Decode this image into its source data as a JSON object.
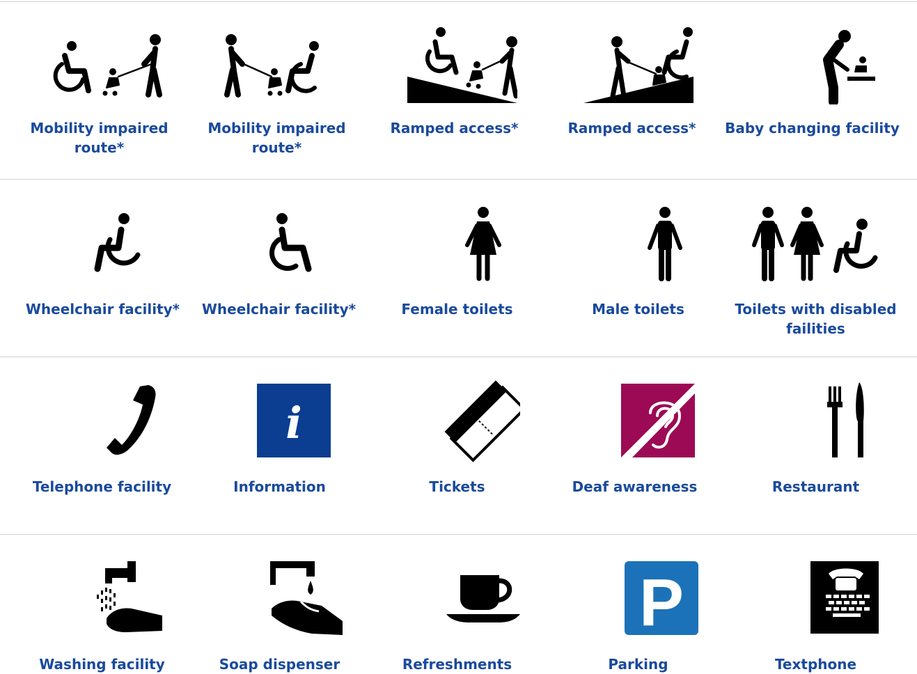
{
  "colors": {
    "label": "#1a4a9c",
    "info_blue": "#0b3d91",
    "deaf": "#9c0a55",
    "parking": "#1c72b8",
    "rule": "#d0d0d0"
  },
  "rows": [
    {
      "items": [
        {
          "label": "Mobility impaired route*",
          "icon": "wheelchair-stroller-icon"
        },
        {
          "label": "Mobility impaired route*",
          "icon": "stroller-wheelchair-icon"
        },
        {
          "label": "Ramped access*",
          "icon": "ramp-up-icon"
        },
        {
          "label": "Ramped access*",
          "icon": "ramp-down-icon"
        },
        {
          "label": "Baby changing facility",
          "icon": "baby-changing-icon"
        }
      ]
    },
    {
      "items": [
        {
          "label": "Wheelchair facility*",
          "icon": "wheelchair-left-icon"
        },
        {
          "label": "Wheelchair facility*",
          "icon": "wheelchair-right-icon"
        },
        {
          "label": "Female toilets",
          "icon": "female-icon"
        },
        {
          "label": "Male toilets",
          "icon": "male-icon"
        },
        {
          "label": "Toilets with disabled failities",
          "icon": "accessible-toilets-icon"
        }
      ]
    },
    {
      "items": [
        {
          "label": "Telephone facility",
          "icon": "telephone-icon"
        },
        {
          "label": "Information",
          "icon": "information-icon",
          "glyph": "i"
        },
        {
          "label": "Tickets",
          "icon": "ticket-icon"
        },
        {
          "label": "Deaf awareness",
          "icon": "ear-icon"
        },
        {
          "label": "Restaurant",
          "icon": "fork-knife-icon"
        }
      ]
    },
    {
      "items": [
        {
          "label": "Washing facility",
          "icon": "washing-hands-icon"
        },
        {
          "label": "Soap dispenser",
          "icon": "soap-dispenser-icon"
        },
        {
          "label": "Refreshments",
          "icon": "cup-icon"
        },
        {
          "label": "Parking",
          "icon": "parking-icon",
          "glyph": "P"
        },
        {
          "label": "Textphone",
          "icon": "textphone-icon"
        }
      ]
    }
  ]
}
